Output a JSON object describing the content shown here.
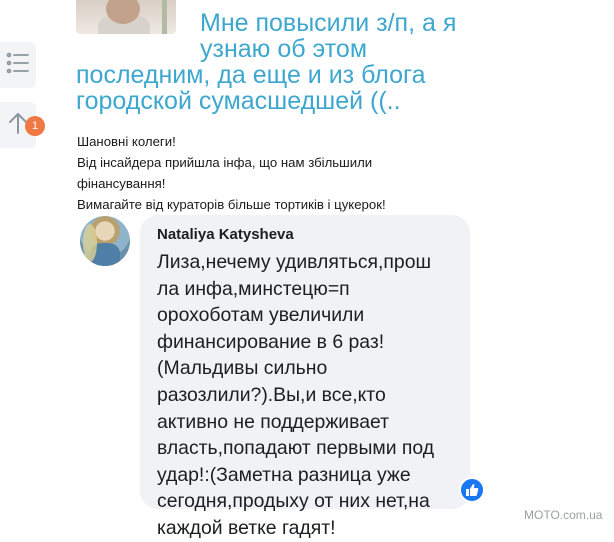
{
  "article": {
    "title_lines": [
      "Мне повысили з/п, а я",
      "узнаю об этом",
      "последним, да еще и из блога",
      "городской сумасшедшей ((.."
    ]
  },
  "toolbar": {
    "list_icon": "list-icon",
    "scroll_up_icon": "arrow-up-icon",
    "badge_count": "1",
    "badge_color": "#ef7845"
  },
  "post": {
    "lines": [
      "Шановні колеги!",
      "Від інсайдера прийшла інфа, що нам збільшили",
      "фінансування!",
      "Вимагайте від кураторів більше тортиків і цукерок!"
    ]
  },
  "comment": {
    "author": "Nataliya Katysheva",
    "lines": [
      "Лиза,нечему удивляться,прош",
      "ла инфа,минстецю=п",
      "орохоботам увеличили",
      "финансирование в 6 раз!",
      "(Мальдивы сильно",
      "разозлили?).Вы,и все,кто",
      "активно не поддерживает",
      "власть,попадают первыми под",
      "удар!:(Заметна разница уже",
      "сегодня,продыху от них нет,на",
      "каждой ветке гадят!"
    ],
    "reaction_icon": "like-icon",
    "bubble_color": "#f0f2f5"
  },
  "watermark": "MOTO.com.ua",
  "colors": {
    "headline": "#3ea7cf",
    "like": "#1877f2"
  }
}
